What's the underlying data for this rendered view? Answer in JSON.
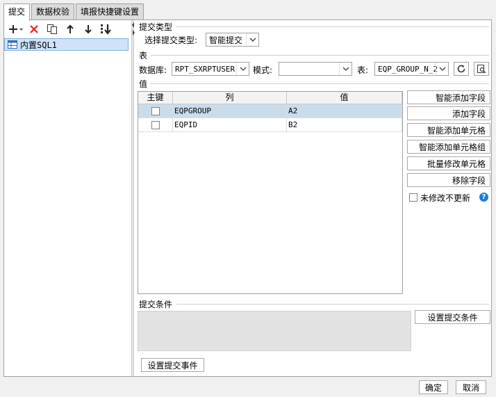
{
  "tabs": [
    {
      "label": "提交",
      "active": true
    },
    {
      "label": "数据校验",
      "active": false
    },
    {
      "label": "填报快捷键设置",
      "active": false
    }
  ],
  "toolbar": {
    "icons": [
      "add-icon",
      "delete-icon",
      "copy-icon",
      "move-up-icon",
      "move-down-icon",
      "sort-icon"
    ]
  },
  "tree": {
    "items": [
      {
        "label": "内置SQL1"
      }
    ]
  },
  "submit_type": {
    "section_title": "提交类型",
    "label": "选择提交类型:",
    "value": "智能提交"
  },
  "table_section": {
    "section_title": "表",
    "db_label": "数据库:",
    "db_value": "RPT_SXRPTUSER",
    "schema_label": "模式:",
    "schema_value": "",
    "table_label": "表:",
    "table_value": "EQP_GROUP_N_2"
  },
  "value_section": {
    "section_title": "值",
    "columns": [
      "主键",
      "列",
      "值"
    ],
    "rows": [
      {
        "key": false,
        "column": "EQPGROUP",
        "value": "A2",
        "selected": true
      },
      {
        "key": false,
        "column": "EQPID",
        "value": "B2",
        "selected": false
      }
    ],
    "buttons": [
      "智能添加字段",
      "添加字段",
      "智能添加单元格",
      "智能添加单元格组",
      "批量修改单元格",
      "移除字段"
    ],
    "no_update_label": "未修改不更新"
  },
  "condition": {
    "section_title": "提交条件",
    "button": "设置提交条件"
  },
  "event_button": "设置提交事件",
  "footer": {
    "ok": "确定",
    "cancel": "取消"
  },
  "colors": {
    "accent": "#1a7de0",
    "delete": "#e02020",
    "selection": "#cfe2f7"
  }
}
